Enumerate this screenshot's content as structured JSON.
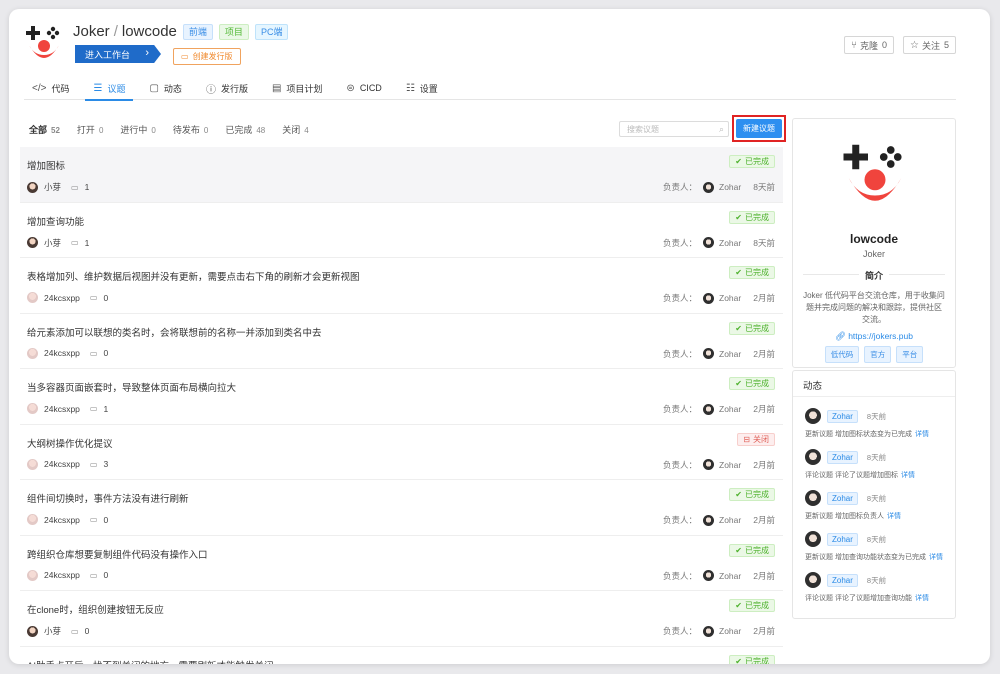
{
  "header": {
    "owner": "Joker",
    "repo": "lowcode",
    "tags": [
      "前端",
      "项目",
      "PC端"
    ],
    "enter_label": "进入工作台",
    "release_label": "创建发行版",
    "clone_label": "克隆",
    "clone_count": "0",
    "follow_label": "关注",
    "follow_count": "5"
  },
  "tabs": [
    {
      "label": "代码",
      "icon": "code-icon"
    },
    {
      "label": "议题",
      "icon": "list-icon",
      "active": true
    },
    {
      "label": "动态",
      "icon": "chat-icon"
    },
    {
      "label": "发行版",
      "icon": "info-circle-icon"
    },
    {
      "label": "项目计划",
      "icon": "table-icon"
    },
    {
      "label": "CICD",
      "icon": "car-icon"
    },
    {
      "label": "设置",
      "icon": "sliders-icon"
    }
  ],
  "filters": [
    {
      "label": "全部",
      "count": "52",
      "active": true
    },
    {
      "label": "打开",
      "count": "0"
    },
    {
      "label": "进行中",
      "count": "0"
    },
    {
      "label": "待发布",
      "count": "0"
    },
    {
      "label": "已完成",
      "count": "48"
    },
    {
      "label": "关闭",
      "count": "4"
    }
  ],
  "search_placeholder": "搜索议题",
  "new_issue_label": "新建议题",
  "owner_label": "负责人：",
  "issues": [
    {
      "title": "增加图标",
      "status": "已完成",
      "status_type": "done",
      "author": "小芽",
      "author_avatar": "girl",
      "comments": "1",
      "assignee": "Zohar",
      "time": "8天前"
    },
    {
      "title": "增加查询功能",
      "status": "已完成",
      "status_type": "done",
      "author": "小芽",
      "author_avatar": "girl",
      "comments": "1",
      "assignee": "Zohar",
      "time": "8天前"
    },
    {
      "title": "表格增加列、维护数据后视图并没有更新，需要点击右下角的刷新才会更新视图",
      "status": "已完成",
      "status_type": "done",
      "author": "24kcsxpp",
      "author_avatar": "gray",
      "comments": "0",
      "assignee": "Zohar",
      "time": "2月前"
    },
    {
      "title": "给元素添加可以联想的类名时，会将联想前的名称一并添加到类名中去",
      "status": "已完成",
      "status_type": "done",
      "author": "24kcsxpp",
      "author_avatar": "gray",
      "comments": "0",
      "assignee": "Zohar",
      "time": "2月前"
    },
    {
      "title": "当多容器页面嵌套时，导致整体页面布局横向拉大",
      "status": "已完成",
      "status_type": "done",
      "author": "24kcsxpp",
      "author_avatar": "gray",
      "comments": "1",
      "assignee": "Zohar",
      "time": "2月前"
    },
    {
      "title": "大纲树操作优化提议",
      "status": "关闭",
      "status_type": "closed",
      "author": "24kcsxpp",
      "author_avatar": "gray",
      "comments": "3",
      "assignee": "Zohar",
      "time": "2月前"
    },
    {
      "title": "组件间切换时，事件方法没有进行刷新",
      "status": "已完成",
      "status_type": "done",
      "author": "24kcsxpp",
      "author_avatar": "gray",
      "comments": "0",
      "assignee": "Zohar",
      "time": "2月前"
    },
    {
      "title": "跨组织仓库想要复制组件代码没有操作入口",
      "status": "已完成",
      "status_type": "done",
      "author": "24kcsxpp",
      "author_avatar": "gray",
      "comments": "0",
      "assignee": "Zohar",
      "time": "2月前"
    },
    {
      "title": "在clone时，组织创建按钮无反应",
      "status": "已完成",
      "status_type": "done",
      "author": "小芽",
      "author_avatar": "girl",
      "comments": "0",
      "assignee": "Zohar",
      "time": "2月前"
    },
    {
      "title": "AI助手点开后，找不到关闭的地方，需要刷新才能触发关闭",
      "status": "已完成",
      "status_type": "done",
      "author": "",
      "author_avatar": "gray",
      "comments": "",
      "assignee": "",
      "time": ""
    }
  ],
  "project_card": {
    "name": "lowcode",
    "owner": "Joker",
    "intro_heading": "简介",
    "description": "Joker 低代码平台交流仓库，用于收集问题并完成问题的解决和跟踪，提供社区交流。",
    "link": "https://jokers.pub",
    "tags": [
      "低代码",
      "官方",
      "平台"
    ]
  },
  "activity": {
    "heading": "动态",
    "details_label": "详情",
    "items": [
      {
        "user": "Zohar",
        "time": "8天前",
        "text": "更新议题 增加图标状态变为已完成"
      },
      {
        "user": "Zohar",
        "time": "8天前",
        "text": "评论议题 评论了议题增加图标"
      },
      {
        "user": "Zohar",
        "time": "8天前",
        "text": "更新议题 增加图标负责人"
      },
      {
        "user": "Zohar",
        "time": "8天前",
        "text": "更新议题 增加查询功能状态变为已完成"
      },
      {
        "user": "Zohar",
        "time": "8天前",
        "text": "评论议题 评论了议题增加查询功能"
      }
    ]
  },
  "colors": {
    "accent": "#2b8be6",
    "done": "#4fb22e",
    "closed": "#e0625a",
    "highlight_border": "#e02323",
    "logo_red": "#f0443d"
  }
}
